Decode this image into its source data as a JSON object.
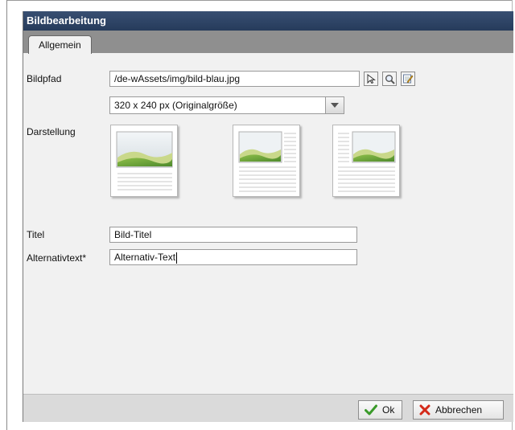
{
  "dialog": {
    "title": "Bildbearbeitung",
    "tabs": [
      {
        "label": "Allgemein",
        "active": true
      }
    ]
  },
  "form": {
    "bildpfad_label": "Bildpfad",
    "bildpfad_value": "/de-wAssets/img/bild-blau.jpg",
    "size_select_value": "320 x 240 px (Originalgröße)",
    "darstellung_label": "Darstellung",
    "layout_options": [
      "image-top-text-below",
      "image-left-text-right",
      "image-right-text-left"
    ],
    "titel_label": "Titel",
    "titel_value": "Bild-Titel",
    "alt_label": "Alternativtext*",
    "alt_value": "Alternativ-Text"
  },
  "icons": {
    "browse": "cursor-arrow-icon",
    "search": "magnifier-icon",
    "edit": "edit-note-icon"
  },
  "footer": {
    "ok_label": "Ok",
    "cancel_label": "Abbrechen"
  },
  "colors": {
    "titlebar": "#2e4567",
    "ok_check": "#3a9a2a",
    "cancel_x": "#d42a1a"
  }
}
